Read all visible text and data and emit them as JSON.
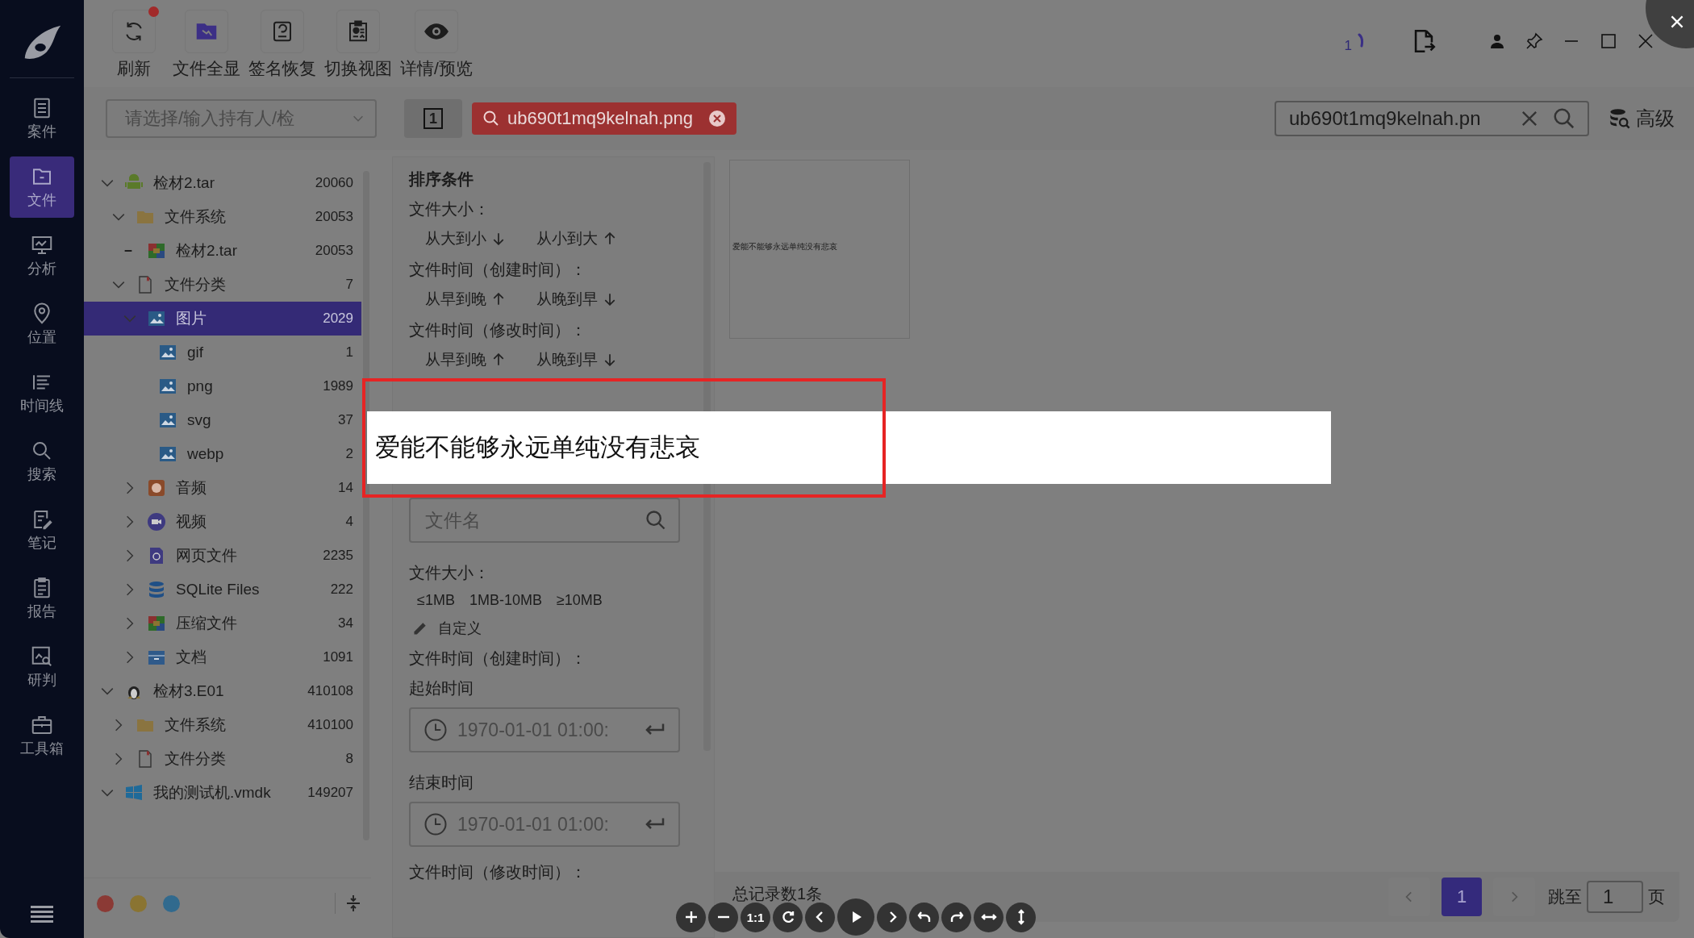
{
  "nav": {
    "items": [
      {
        "label": "案件",
        "kind": "case",
        "selected": false
      },
      {
        "label": "文件",
        "kind": "file",
        "selected": true
      },
      {
        "label": "分析",
        "kind": "analysis",
        "selected": false
      },
      {
        "label": "位置",
        "kind": "pin",
        "selected": false
      },
      {
        "label": "时间线",
        "kind": "timeline",
        "selected": false
      },
      {
        "label": "搜索",
        "kind": "search",
        "selected": false
      },
      {
        "label": "笔记",
        "kind": "note",
        "selected": false
      },
      {
        "label": "报告",
        "kind": "report",
        "selected": false
      },
      {
        "label": "研判",
        "kind": "judge",
        "selected": false
      },
      {
        "label": "工具箱",
        "kind": "toolbox",
        "selected": false
      }
    ]
  },
  "toolbar": {
    "buttons": [
      {
        "label": "刷新",
        "kind": "refresh",
        "badge": true
      },
      {
        "label": "文件全显",
        "kind": "folder",
        "badge": false
      },
      {
        "label": "签名恢复",
        "kind": "disk",
        "badge": false
      },
      {
        "label": "切换视图",
        "kind": "clipboard",
        "badge": false
      },
      {
        "label": "详情/预览",
        "kind": "eye",
        "badge": false
      }
    ]
  },
  "task_counter": "1",
  "case_selector": {
    "placeholder": "请选择/输入持有人/检"
  },
  "view_toggle": "1",
  "search_tag": "ub690t1mq9kelnah.png",
  "search_field": {
    "value": "ub690t1mq9kelnah.pn"
  },
  "advanced_button": "高级",
  "tree": {
    "items": [
      {
        "label": "检材2.tar",
        "count": "20060",
        "kind": "android",
        "expanded": true,
        "selected": false,
        "children": [
          {
            "label": "文件系统",
            "count": "20053",
            "kind": "folder",
            "expanded": true,
            "selected": false,
            "children": [
              {
                "label": "检材2.tar",
                "count": "20053",
                "kind": "archive",
                "empty": true,
                "selected": false
              }
            ]
          },
          {
            "label": "文件分类",
            "count": "7",
            "kind": "doc",
            "expanded": true,
            "selected": false,
            "children": [
              {
                "label": "图片",
                "count": "2029",
                "kind": "image",
                "expanded": true,
                "selected": true,
                "children": [
                  {
                    "label": "gif",
                    "count": "1",
                    "kind": "image",
                    "selected": false
                  },
                  {
                    "label": "png",
                    "count": "1989",
                    "kind": "image",
                    "selected": false
                  },
                  {
                    "label": "svg",
                    "count": "37",
                    "kind": "image",
                    "selected": false
                  },
                  {
                    "label": "webp",
                    "count": "2",
                    "kind": "image",
                    "selected": false
                  }
                ]
              },
              {
                "label": "音频",
                "count": "14",
                "kind": "audio",
                "expanded": false,
                "selected": false
              },
              {
                "label": "视频",
                "count": "4",
                "kind": "video",
                "expanded": false,
                "selected": false
              },
              {
                "label": "网页文件",
                "count": "2235",
                "kind": "web",
                "expanded": false,
                "selected": false
              },
              {
                "label": "SQLite Files",
                "count": "222",
                "kind": "database",
                "expanded": false,
                "selected": false
              },
              {
                "label": "压缩文件",
                "count": "34",
                "kind": "archive",
                "expanded": false,
                "selected": false
              },
              {
                "label": "文档",
                "count": "1091",
                "kind": "box",
                "expanded": false,
                "selected": false
              }
            ]
          }
        ]
      },
      {
        "label": "检材3.E01",
        "count": "410108",
        "kind": "linux",
        "expanded": true,
        "selected": false,
        "children": [
          {
            "label": "文件系统",
            "count": "410100",
            "kind": "folder",
            "expanded": false,
            "selected": false
          },
          {
            "label": "文件分类",
            "count": "8",
            "kind": "doc",
            "expanded": false,
            "selected": false
          }
        ]
      },
      {
        "label": "我的测试机.vmdk",
        "count": "149207",
        "kind": "windows",
        "expanded": true,
        "selected": false
      }
    ]
  },
  "color_dots": [
    {
      "color": "#8b3a35"
    },
    {
      "color": "#8a7432"
    },
    {
      "color": "#316a8e"
    }
  ],
  "sort_panel": {
    "title": "排序条件",
    "groups": [
      {
        "label": "文件大小：",
        "options": [
          {
            "label": "从大到小",
            "kind": "down"
          },
          {
            "label": "从小到大",
            "kind": "up"
          }
        ]
      },
      {
        "label": "文件时间（创建时间）：",
        "options": [
          {
            "label": "从早到晚",
            "kind": "up"
          },
          {
            "label": "从晚到早",
            "kind": "down"
          }
        ]
      },
      {
        "label": "文件时间（修改时间）：",
        "options": [
          {
            "label": "从早到晚",
            "kind": "up"
          },
          {
            "label": "从晚到早",
            "kind": "down"
          }
        ]
      }
    ]
  },
  "filter_panel": {
    "name_placeholder": "文件名",
    "size_label": "文件大小：",
    "sizes": [
      "≤1MB",
      "1MB-10MB",
      "≥10MB"
    ],
    "custom": "自定义",
    "created_label": "文件时间（创建时间）：",
    "start_label": "起始时间",
    "start_placeholder": "1970-01-01 01:00:",
    "end_label": "结束时间",
    "end_placeholder": "1970-01-01 01:00:",
    "modified_label": "文件时间（修改时间）："
  },
  "thumbnail_text": "爱能不能够永远单纯没有悲哀",
  "total": "总记录数1条",
  "pagination": {
    "pages": [
      {
        "label": "1",
        "selected": true
      }
    ],
    "jump_label": "跳至",
    "jump_value": "1",
    "suffix": "页"
  },
  "viewer": {
    "image_text": "爱能不能够永远单纯没有悲哀",
    "highlight": true,
    "tools": [
      {
        "kind": "zoom-in"
      },
      {
        "kind": "zoom-out"
      },
      {
        "kind": "actual",
        "label": "1:1"
      },
      {
        "kind": "rotate"
      },
      {
        "kind": "prev"
      },
      {
        "kind": "play"
      },
      {
        "kind": "next"
      },
      {
        "kind": "undo"
      },
      {
        "kind": "redo"
      },
      {
        "kind": "flip-h"
      },
      {
        "kind": "flip-v"
      }
    ]
  }
}
